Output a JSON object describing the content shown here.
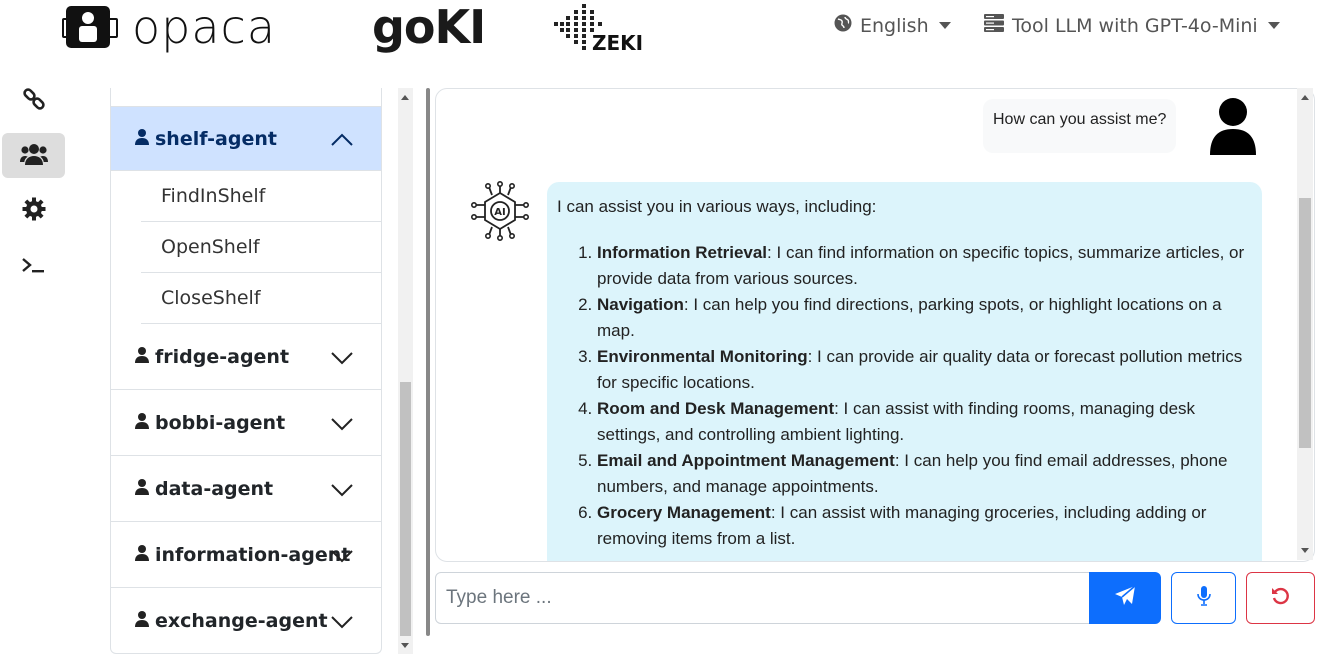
{
  "header": {
    "logos": {
      "opaca": "opaca",
      "goki": "goKI",
      "zeki": "ZEKI"
    },
    "language": {
      "label": "English",
      "icon": "globe-icon"
    },
    "backend": {
      "label": "Tool LLM with GPT-4o-Mini",
      "icon": "server-icon"
    }
  },
  "rail": {
    "items": [
      {
        "name": "link-icon"
      },
      {
        "name": "users-icon",
        "active": true
      },
      {
        "name": "gear-icon"
      },
      {
        "name": "terminal-icon"
      }
    ]
  },
  "agents": {
    "open": {
      "name": "shelf-agent",
      "actions": [
        "FindInShelf",
        "OpenShelf",
        "CloseShelf"
      ]
    },
    "collapsed": [
      "fridge-agent",
      "bobbi-agent",
      "data-agent",
      "information-agent",
      "exchange-agent"
    ]
  },
  "chat": {
    "user_message": "How can you assist me?",
    "ai_intro": "I can assist you in various ways, including:",
    "ai_items": [
      {
        "title": "Information Retrieval",
        "text": ": I can find information on specific topics, summarize articles, or provide data from various sources."
      },
      {
        "title": "Navigation",
        "text": ": I can help you find directions, parking spots, or highlight locations on a map."
      },
      {
        "title": "Environmental Monitoring",
        "text": ": I can provide air quality data or forecast pollution metrics for specific locations."
      },
      {
        "title": "Room and Desk Management",
        "text": ": I can assist with finding rooms, managing desk settings, and controlling ambient lighting."
      },
      {
        "title": "Email and Appointment Management",
        "text": ": I can help you find email addresses, phone numbers, and manage appointments."
      },
      {
        "title": "Grocery Management",
        "text": ": I can assist with managing groceries, including adding or removing items from a list."
      }
    ]
  },
  "input": {
    "placeholder": "Type here ...",
    "value": ""
  },
  "colors": {
    "primary": "#0d6efd",
    "danger": "#dc3545",
    "agent_open_bg": "#cfe2ff",
    "ai_bubble": "#dcf4fb"
  }
}
